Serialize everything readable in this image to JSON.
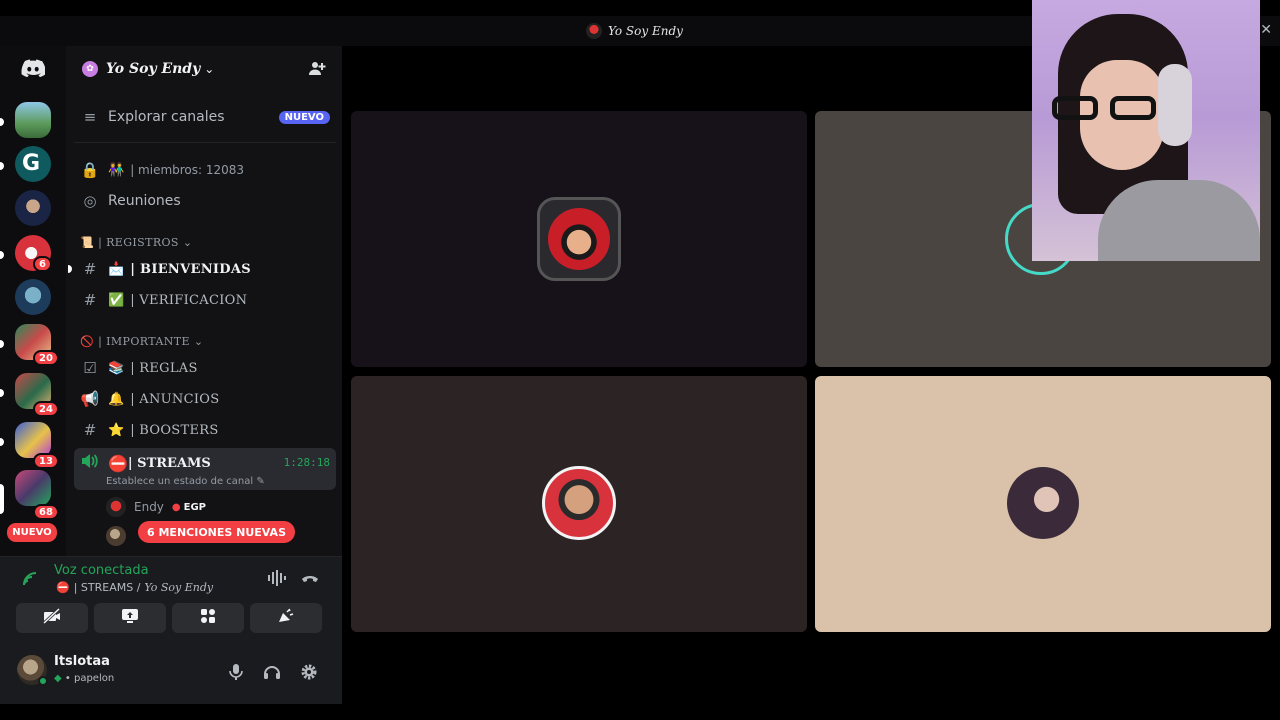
{
  "window": {
    "title": "Yo Soy Endy"
  },
  "rail": {
    "badges": [
      "6",
      "20",
      "24",
      "13",
      "68"
    ],
    "new_label": "NUEVO"
  },
  "server": {
    "name": "Yo Soy Endy"
  },
  "channels": {
    "explore": {
      "label": "Explorar canales",
      "badge": "NUEVO"
    },
    "members": {
      "label": "| miembros: 12083"
    },
    "meetings": {
      "label": "Reuniones"
    },
    "cat_registros": "| REGISTROS",
    "bienvenidas": "| BIENVENIDAS",
    "verificacion": "| VERIFICACION",
    "cat_importante": "| IMPORTANTE",
    "reglas": "| REGLAS",
    "anuncios": "| ANUNCIOS",
    "boosters": "| BOOSTERS",
    "streams": {
      "label": "| STREAMS",
      "timer": "1:28:18",
      "status": "Establece un estado de canal"
    },
    "voice_users": [
      {
        "name": "Endy",
        "tag": "EGP"
      }
    ],
    "mentions": "6 MENCIONES NUEVAS"
  },
  "voice": {
    "status": "Voz conectada",
    "channel": "| STREAMS /",
    "server": "Yo Soy Endy"
  },
  "user": {
    "name": "Itslotaa",
    "status": "• papelon"
  },
  "colors": {
    "accent": "#5865f2",
    "online": "#23a55a",
    "danger": "#f23f43"
  }
}
